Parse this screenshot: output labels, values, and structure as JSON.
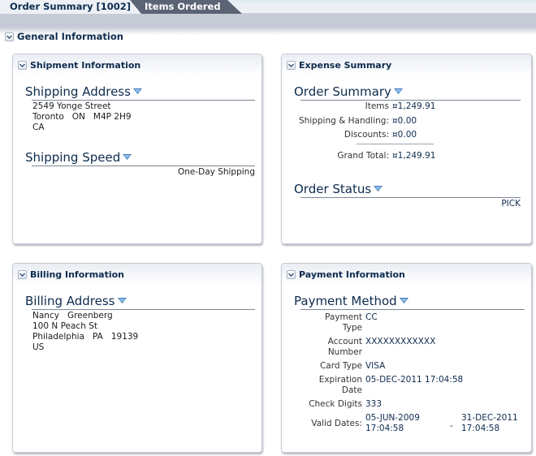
{
  "tabs": [
    {
      "label": "Order Summary [1002]",
      "active": true
    },
    {
      "label": "Items Ordered",
      "active": false
    }
  ],
  "general": {
    "title": "General Information"
  },
  "shipment": {
    "title": "Shipment Information",
    "address_title": "Shipping Address",
    "address": {
      "street": "2549 Yonge Street",
      "city": "Toronto",
      "state": "ON",
      "postal": "M4P 2H9",
      "country": "CA"
    },
    "speed_title": "Shipping Speed",
    "speed": "One-Day Shipping"
  },
  "expense": {
    "title": "Expense Summary",
    "order_title": "Order Summary",
    "rows": [
      {
        "label": "Items",
        "value": "¤1,249.91"
      },
      {
        "label": "Shipping & Handling:",
        "value": "¤0.00"
      },
      {
        "label": "Discounts:",
        "value": "¤0.00"
      }
    ],
    "grand_total": {
      "label": "Grand Total:",
      "value": "¤1,249.91"
    },
    "status_title": "Order Status",
    "status": "PICK"
  },
  "billing": {
    "title": "Billing Information",
    "address_title": "Billing Address",
    "address": {
      "first": "Nancy",
      "last": "Greenberg",
      "street": "100 N Peach St",
      "city": "Philadelphia",
      "state": "PA",
      "postal": "19139",
      "country": "US"
    }
  },
  "payment": {
    "title": "Payment Information",
    "method_title": "Payment Method",
    "rows": [
      {
        "label_1": "Payment",
        "label_2": "Type",
        "value": "CC"
      },
      {
        "label_1": "Account",
        "label_2": "Number",
        "value": "XXXXXXXXXXXX"
      },
      {
        "label_1": "Card Type",
        "label_2": "",
        "value": "VISA"
      },
      {
        "label_1": "Expiration",
        "label_2": "Date",
        "value": "05-DEC-2011 17:04:58"
      },
      {
        "label_1": "Check Digits",
        "label_2": "",
        "value": "333"
      }
    ],
    "valid": {
      "label": "Valid Dates:",
      "from_date": "05-JUN-2009",
      "from_time": "17:04:58",
      "sep": "-",
      "to_date": "31-DEC-2011",
      "to_time": "17:04:58"
    }
  }
}
